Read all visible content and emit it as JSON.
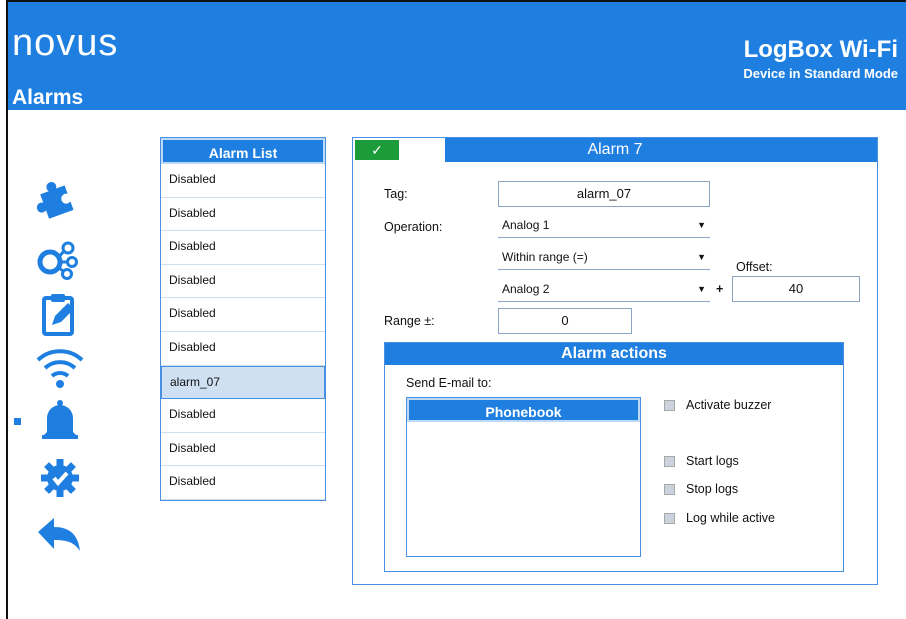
{
  "header": {
    "logo": "novus",
    "page_title": "Alarms",
    "product": "LogBox Wi-Fi",
    "mode": "Device in Standard Mode"
  },
  "nav": {
    "icons": [
      "puzzle-icon",
      "network-icon",
      "clipboard-icon",
      "wifi-icon",
      "bell-icon",
      "gear-check-icon",
      "back-arrow-icon"
    ],
    "active": "bell-icon"
  },
  "alarm_list": {
    "title": "Alarm  List",
    "items": [
      "Disabled",
      "Disabled",
      "Disabled",
      "Disabled",
      "Disabled",
      "Disabled",
      "alarm_07",
      "Disabled",
      "Disabled",
      "Disabled"
    ],
    "selected_index": 6
  },
  "alarm": {
    "toggle_symbol": "✓",
    "title": "Alarm  7",
    "tag_label": "Tag:",
    "tag_value": "alarm_07",
    "operation_label": "Operation:",
    "operation_value": "Analog 1",
    "condition_value": "Within range (=)",
    "operand_value": "Analog 2",
    "plus": "+",
    "offset_label": "Offset:",
    "offset_value": "40",
    "range_label": "Range ±:",
    "range_value": "0"
  },
  "actions": {
    "title": "Alarm actions",
    "send_email_label": "Send E-mail to:",
    "phonebook_title": "Phonebook",
    "activate_buzzer": "Activate buzzer",
    "start_logs": "Start logs",
    "stop_logs": "Stop logs",
    "log_while_active": "Log while active"
  },
  "colors": {
    "brand": "#1f7fe0",
    "toggle_on": "#1c9b3a",
    "selected_row": "#cfe0f3"
  }
}
